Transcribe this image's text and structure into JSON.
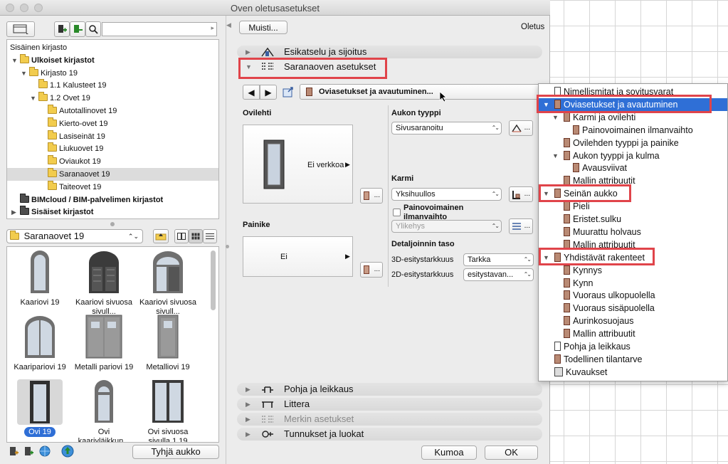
{
  "window": {
    "title": "Oven oletusasetukset"
  },
  "left": {
    "tree": [
      {
        "label": "Sisäinen kirjasto",
        "level": 0,
        "bold": false,
        "arrow": "",
        "folder": "none"
      },
      {
        "label": "Ulkoiset kirjastot",
        "level": 0,
        "bold": true,
        "arrow": "▼",
        "folder": "yellow"
      },
      {
        "label": "Kirjasto 19",
        "level": 1,
        "bold": false,
        "arrow": "▼",
        "folder": "yellow"
      },
      {
        "label": "1.1 Kalusteet 19",
        "level": 2,
        "bold": false,
        "arrow": "",
        "folder": "yellow"
      },
      {
        "label": "1.2 Ovet 19",
        "level": 2,
        "bold": false,
        "arrow": "▼",
        "folder": "yellow"
      },
      {
        "label": "Autotallinovet 19",
        "level": 3,
        "bold": false,
        "arrow": "",
        "folder": "yellow"
      },
      {
        "label": "Kierto-ovet 19",
        "level": 3,
        "bold": false,
        "arrow": "",
        "folder": "yellow"
      },
      {
        "label": "Lasiseinät 19",
        "level": 3,
        "bold": false,
        "arrow": "",
        "folder": "yellow"
      },
      {
        "label": "Liukuovet 19",
        "level": 3,
        "bold": false,
        "arrow": "",
        "folder": "yellow"
      },
      {
        "label": "Oviaukot 19",
        "level": 3,
        "bold": false,
        "arrow": "",
        "folder": "yellow"
      },
      {
        "label": "Saranaovet 19",
        "level": 3,
        "bold": false,
        "arrow": "",
        "folder": "yellow",
        "selected": true
      },
      {
        "label": "Taiteovet 19",
        "level": 3,
        "bold": false,
        "arrow": "",
        "folder": "yellow"
      },
      {
        "label": "BIMcloud / BIM-palvelimen kirjastot",
        "level": 0,
        "bold": true,
        "arrow": "",
        "folder": "dark"
      },
      {
        "label": "Sisäiset kirjastot",
        "level": 0,
        "bold": true,
        "arrow": "▶",
        "folder": "dark"
      }
    ],
    "folder_select": "Saranaovet 19",
    "items": [
      {
        "label": "Kaariovi 19",
        "kind": "arch"
      },
      {
        "label": "Kaariovi sivuosa sivull...",
        "kind": "archdouble"
      },
      {
        "label": "Kaariovi sivuosa sivull...",
        "kind": "archside"
      },
      {
        "label": "Kaaripariovi 19",
        "kind": "archpair"
      },
      {
        "label": "Metalli pariovi 19",
        "kind": "metalpair"
      },
      {
        "label": "Metalliovi 19",
        "kind": "metal"
      },
      {
        "label": "Ovi 19",
        "kind": "door",
        "selected": true
      },
      {
        "label": "Ovi kaariyläikkun...",
        "kind": "archtop"
      },
      {
        "label": "Ovi sivuosa sivulla 1 19",
        "kind": "side"
      }
    ],
    "empty_opening_button": "Tyhjä aukko"
  },
  "right": {
    "memo_button": "Muisti...",
    "default_label": "Oletus",
    "sections_top": [
      {
        "label": "Esikatselu ja sijoitus"
      },
      {
        "label": "Saranaoven asetukset"
      }
    ],
    "nav_page": "Oviasetukset ja avautuminen...",
    "leaf_label": "Ovilehti",
    "leaf_value": "Ei verkkoa",
    "handle_label": "Painike",
    "handle_value": "Ei",
    "opening_type_label": "Aukon tyyppi",
    "opening_type_value": "Sivusaranoitu",
    "frame_label": "Karmi",
    "frame_value": "Yksihuullos",
    "gravity_label": "Painovoimainen ilmanvaihto",
    "gravity_value": "Ylikehys",
    "detail_label": "Detaljoinnin taso",
    "detail_3d_label": "3D-esitystarkkuus",
    "detail_3d_value": "Tarkka",
    "detail_2d_label": "2D-esitystarkkuus",
    "detail_2d_value": "esitystavan...",
    "dots": "...",
    "sections_bottom": [
      {
        "label": "Pohja ja leikkaus",
        "dim": false
      },
      {
        "label": "Littera",
        "dim": false
      },
      {
        "label": "Merkin asetukset",
        "dim": true
      },
      {
        "label": "Tunnukset ja luokat",
        "dim": false
      }
    ],
    "cancel_button": "Kumoa",
    "ok_button": "OK"
  },
  "popup": [
    {
      "label": "Nimellismitat ja sovitusvarat",
      "indent": 0,
      "arrow": ""
    },
    {
      "label": "Oviasetukset ja avautuminen",
      "indent": 0,
      "arrow": "▼",
      "highlight": true
    },
    {
      "label": "Karmi ja ovilehti",
      "indent": 1,
      "arrow": "▼"
    },
    {
      "label": "Painovoimainen ilmanvaihto",
      "indent": 2,
      "arrow": ""
    },
    {
      "label": "Ovilehden tyyppi ja painike",
      "indent": 1,
      "arrow": ""
    },
    {
      "label": "Aukon tyyppi ja kulma",
      "indent": 1,
      "arrow": "▼"
    },
    {
      "label": "Avausviivat",
      "indent": 2,
      "arrow": ""
    },
    {
      "label": "Mallin attribuutit",
      "indent": 1,
      "arrow": ""
    },
    {
      "label": "Seinän aukko",
      "indent": 0,
      "arrow": "▼"
    },
    {
      "label": "Pieli",
      "indent": 1,
      "arrow": ""
    },
    {
      "label": "Eristet.sulku",
      "indent": 1,
      "arrow": ""
    },
    {
      "label": "Muurattu holvaus",
      "indent": 1,
      "arrow": ""
    },
    {
      "label": "Mallin attribuutit",
      "indent": 1,
      "arrow": ""
    },
    {
      "label": "Yhdistävät rakenteet",
      "indent": 0,
      "arrow": "▼"
    },
    {
      "label": "Kynnys",
      "indent": 1,
      "arrow": ""
    },
    {
      "label": "Kynn",
      "indent": 1,
      "arrow": ""
    },
    {
      "label": "Vuoraus ulkopuolella",
      "indent": 1,
      "arrow": ""
    },
    {
      "label": "Vuoraus sisäpuolella",
      "indent": 1,
      "arrow": ""
    },
    {
      "label": "Aurinkosuojaus",
      "indent": 1,
      "arrow": ""
    },
    {
      "label": "Mallin attribuutit",
      "indent": 1,
      "arrow": ""
    },
    {
      "label": "Pohja ja leikkaus",
      "indent": 0,
      "arrow": ""
    },
    {
      "label": "Todellinen tilantarve",
      "indent": 0,
      "arrow": ""
    },
    {
      "label": "Kuvaukset",
      "indent": 0,
      "arrow": ""
    }
  ],
  "colors": {
    "highlight": "#2f6fd6",
    "annotation": "#e0444a",
    "folder": "#f2cc4d"
  }
}
